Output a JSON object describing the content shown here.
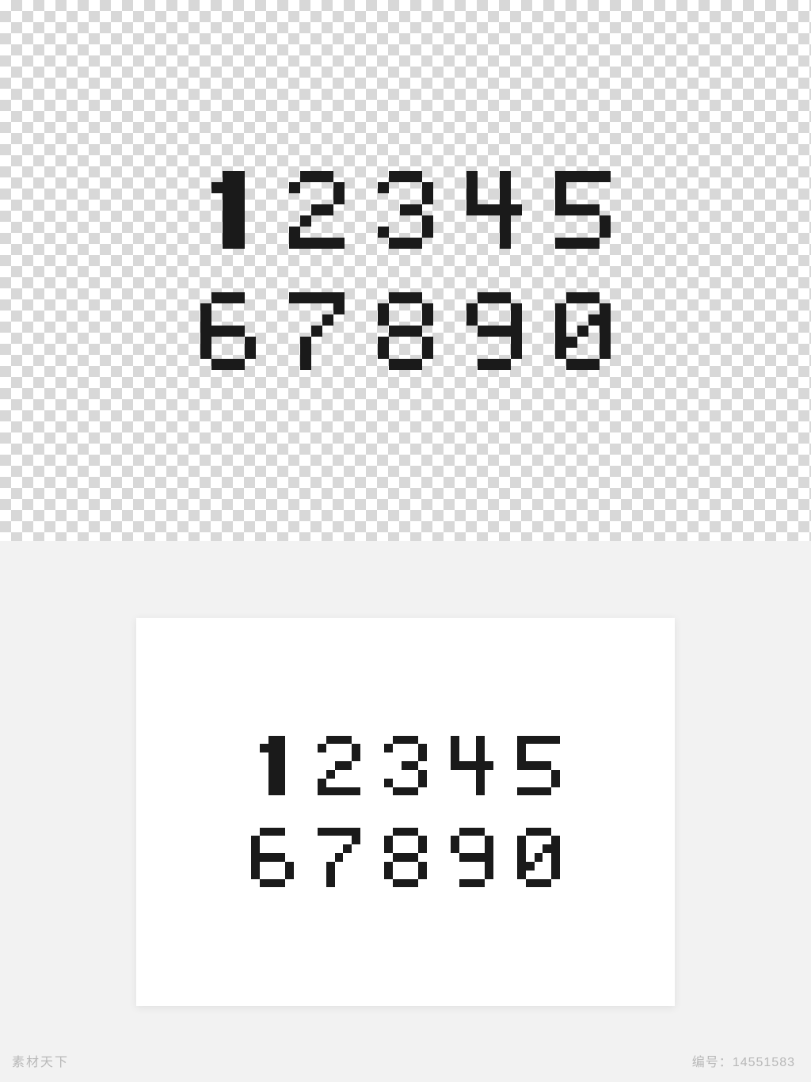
{
  "watermark_left": "素材天下",
  "watermark_right_label": "编号：",
  "watermark_right_value": "14551583",
  "digits_row1": [
    "1",
    "2",
    "3",
    "4",
    "5"
  ],
  "digits_row2": [
    "6",
    "7",
    "8",
    "9",
    "0"
  ],
  "digit_patterns": {
    "0": [
      "01110",
      "10001",
      "10011",
      "10101",
      "11001",
      "10001",
      "01110"
    ],
    "1": [
      "00110",
      "01110",
      "00110",
      "00110",
      "00110",
      "00110",
      "00110"
    ],
    "2": [
      "01110",
      "10001",
      "00001",
      "00110",
      "01000",
      "10000",
      "11111"
    ],
    "3": [
      "01110",
      "10001",
      "00001",
      "00110",
      "00001",
      "10001",
      "01110"
    ],
    "4": [
      "10010",
      "10010",
      "10010",
      "11111",
      "00010",
      "00010",
      "00010"
    ],
    "5": [
      "11111",
      "10000",
      "10000",
      "11110",
      "00001",
      "00001",
      "11110"
    ],
    "6": [
      "01110",
      "10000",
      "10000",
      "11110",
      "10001",
      "10001",
      "01110"
    ],
    "7": [
      "11111",
      "00001",
      "00010",
      "00100",
      "01000",
      "01000",
      "01000"
    ],
    "8": [
      "01110",
      "10001",
      "10001",
      "01110",
      "10001",
      "10001",
      "01110"
    ],
    "9": [
      "01110",
      "10001",
      "10001",
      "01111",
      "00001",
      "00001",
      "01110"
    ]
  }
}
